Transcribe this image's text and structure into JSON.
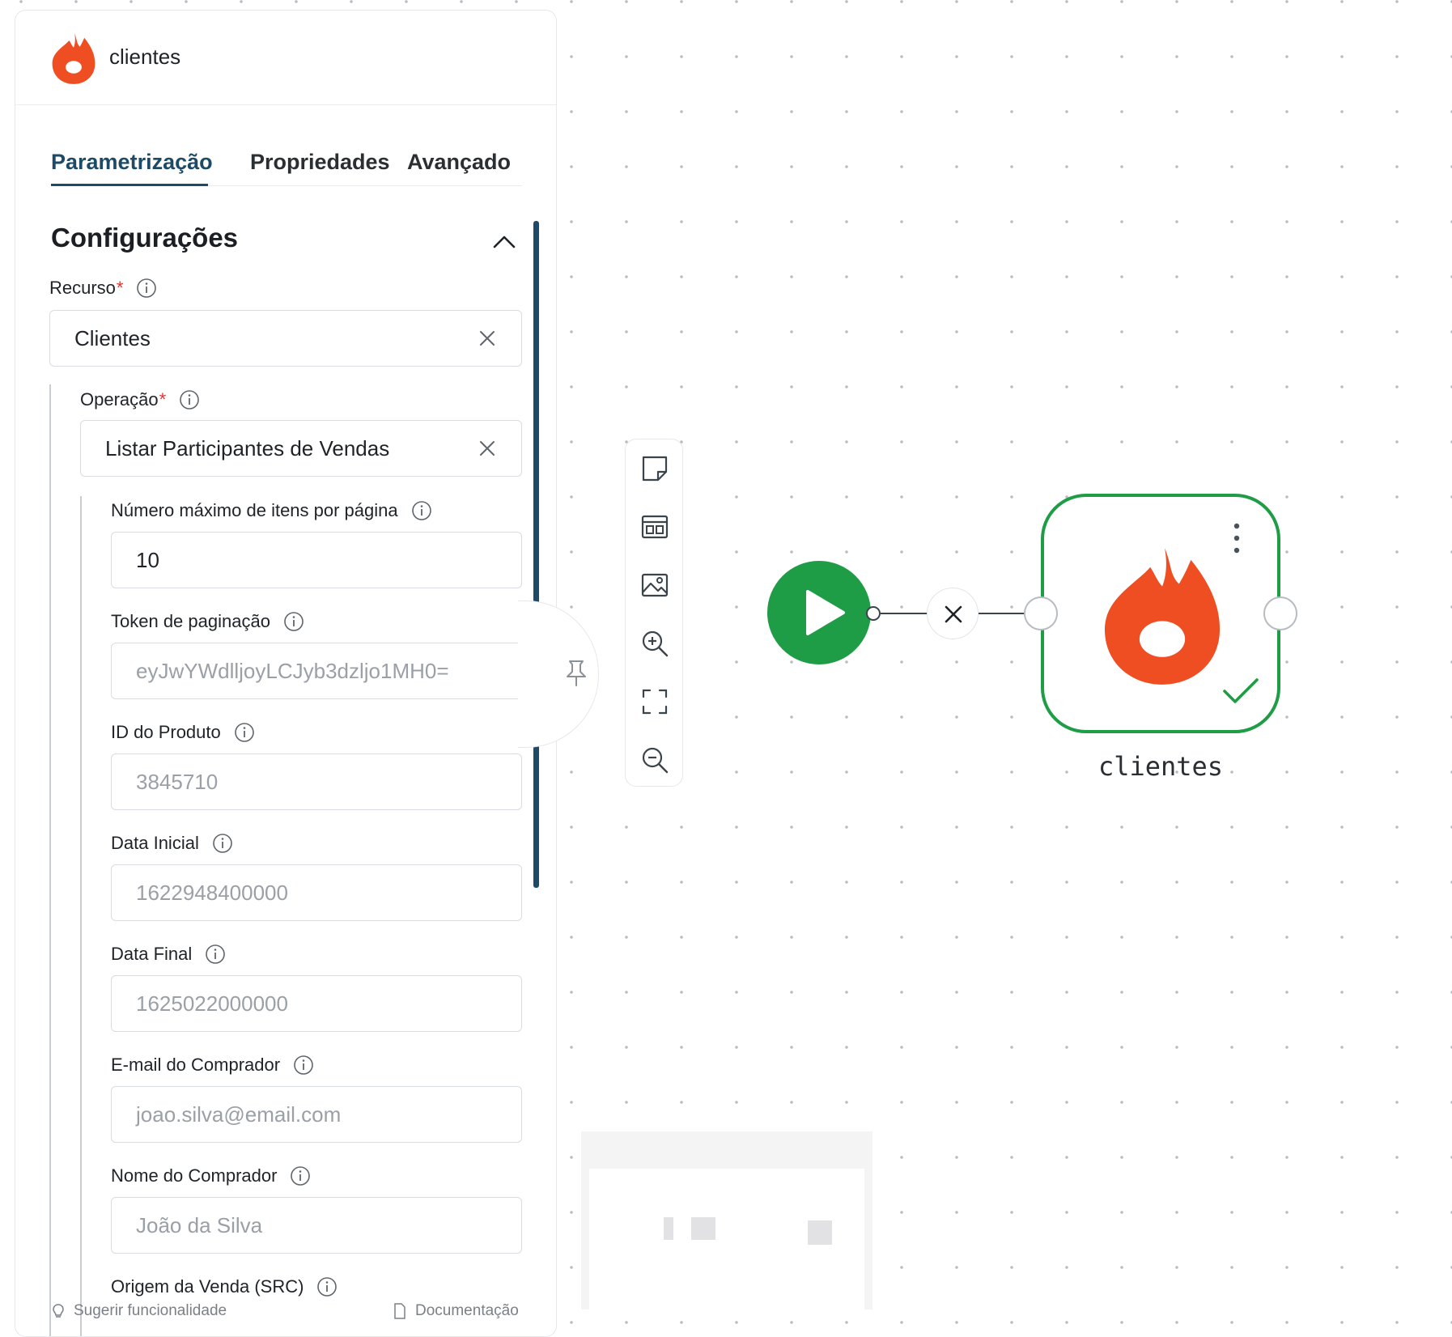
{
  "panel": {
    "title": "clientes",
    "tabs": [
      {
        "label": "Parametrização",
        "active": true
      },
      {
        "label": "Propriedades",
        "active": false
      },
      {
        "label": "Avançado",
        "active": false
      }
    ],
    "section_title": "Configurações",
    "fields": {
      "recurso": {
        "label": "Recurso",
        "value": "Clientes"
      },
      "operacao": {
        "label": "Operação",
        "value": "Listar Participantes de Vendas"
      },
      "max_itens": {
        "label": "Número máximo de itens por página",
        "value": "10"
      },
      "token": {
        "label": "Token de paginação",
        "placeholder": "eyJwYWdlljoyLCJyb3dzljo1MH0="
      },
      "id_produto": {
        "label": "ID do Produto",
        "placeholder": "3845710"
      },
      "data_inicial": {
        "label": "Data Inicial",
        "placeholder": "1622948400000"
      },
      "data_final": {
        "label": "Data Final",
        "placeholder": "1625022000000"
      },
      "email": {
        "label": "E-mail do Comprador",
        "placeholder": "joao.silva@email.com"
      },
      "nome": {
        "label": "Nome do Comprador",
        "placeholder": "João da Silva"
      },
      "origem": {
        "label": "Origem da Venda (SRC)"
      }
    },
    "required_mark": "*",
    "footer": {
      "suggest": "Sugerir funcionalidade",
      "docs": "Documentação"
    }
  },
  "canvas": {
    "node_label": "clientes",
    "toolbar_icons": [
      "sticky-note-icon",
      "layout-icon",
      "image-icon",
      "zoom-in-icon",
      "fit-view-icon",
      "zoom-out-icon"
    ]
  },
  "colors": {
    "brand_flame": "#EF4E23",
    "active_tab": "#1D4A66",
    "success_green": "#1F9C46"
  }
}
